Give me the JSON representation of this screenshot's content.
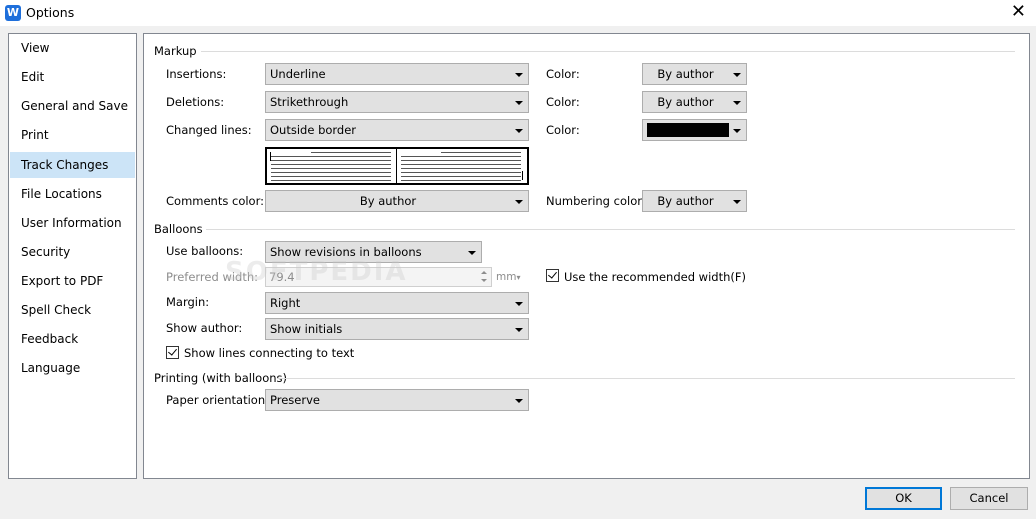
{
  "window": {
    "title": "Options",
    "app_icon": "W"
  },
  "nav": {
    "items": [
      {
        "label": "View"
      },
      {
        "label": "Edit"
      },
      {
        "label": "General and Save"
      },
      {
        "label": "Print"
      },
      {
        "label": "Track Changes",
        "selected": true
      },
      {
        "label": "File Locations"
      },
      {
        "label": "User Information"
      },
      {
        "label": "Security"
      },
      {
        "label": "Export to PDF"
      },
      {
        "label": "Spell Check"
      },
      {
        "label": "Feedback"
      },
      {
        "label": "Language"
      }
    ]
  },
  "markup": {
    "heading": "Markup",
    "insertions": {
      "label": "Insertions:",
      "value": "Underline",
      "color_label": "Color:",
      "color_value": "By author"
    },
    "deletions": {
      "label": "Deletions:",
      "value": "Strikethrough",
      "color_label": "Color:",
      "color_value": "By author"
    },
    "changed_lines": {
      "label": "Changed lines:",
      "value": "Outside border",
      "color_label": "Color:",
      "color_swatch": "#000000"
    },
    "comments_color": {
      "label": "Comments color:",
      "value": "By author"
    },
    "numbering_color": {
      "label": "Numbering color:",
      "value": "By author"
    }
  },
  "balloons": {
    "heading": "Balloons",
    "use_balloons": {
      "label": "Use balloons:",
      "value": "Show revisions in balloons"
    },
    "preferred_width": {
      "label": "Preferred width:",
      "value": "79.4",
      "unit": "mm"
    },
    "use_recommended_width": {
      "label": "Use the recommended width(F)",
      "checked": true
    },
    "margin": {
      "label": "Margin:",
      "value": "Right"
    },
    "show_author": {
      "label": "Show author:",
      "value": "Show initials"
    },
    "show_lines": {
      "label": "Show lines connecting to text",
      "checked": true
    }
  },
  "printing": {
    "heading": "Printing (with balloons)",
    "paper_orientation": {
      "label": "Paper orientation:",
      "value": "Preserve"
    }
  },
  "buttons": {
    "ok": "OK",
    "cancel": "Cancel"
  },
  "watermark": "SOFTPEDIA",
  "colors": {
    "accent": "#0078d7",
    "nav_selected": "#cce4f7"
  }
}
